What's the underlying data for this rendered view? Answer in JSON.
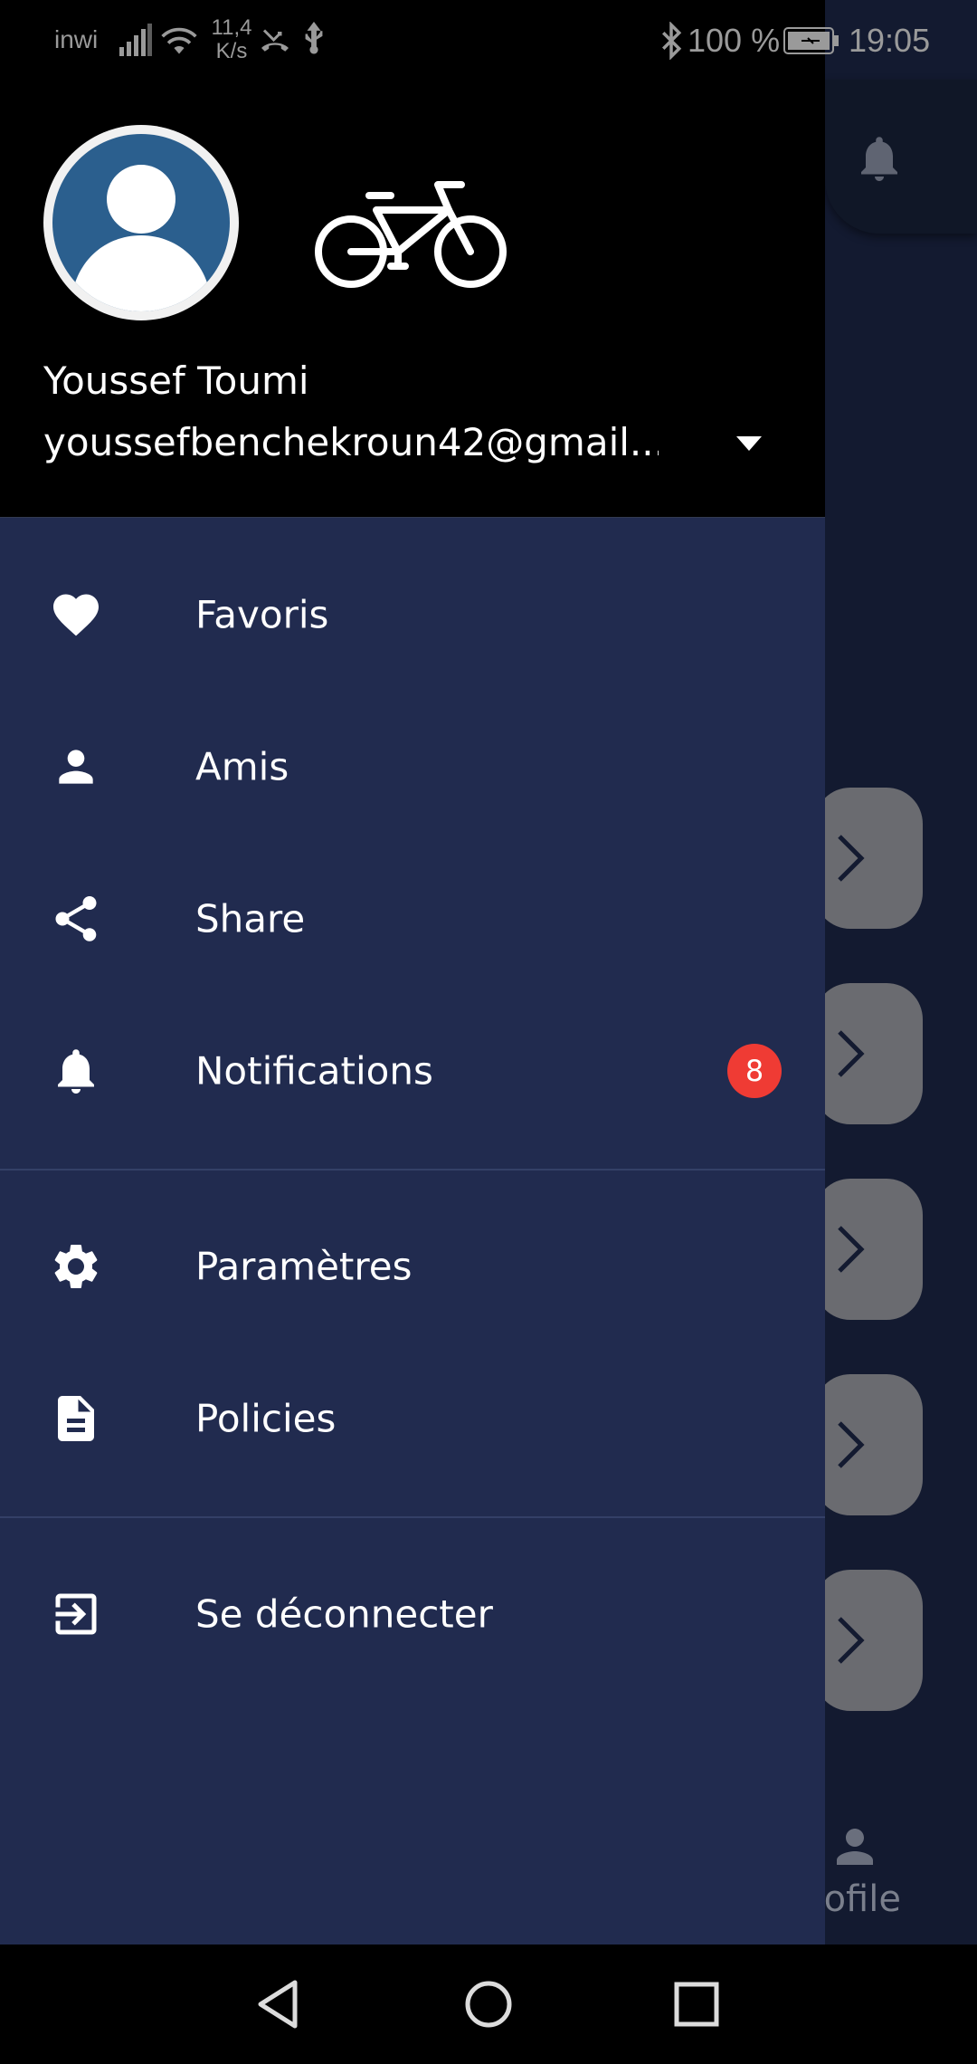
{
  "status_bar": {
    "carrier": "inwi",
    "net_speed_value": "11,4",
    "net_speed_unit": "K/s",
    "battery": "100 %",
    "time": "19:05",
    "icons": [
      "signal-icon",
      "wifi-icon",
      "missed-call-icon",
      "usb-icon",
      "bluetooth-icon",
      "battery-icon"
    ]
  },
  "drawer": {
    "header": {
      "name": "Youssef Toumi",
      "email": "youssefbenchekroun42@gmail...",
      "icons": [
        "avatar-icon",
        "bicycle-icon",
        "dropdown-arrow-icon"
      ]
    },
    "menu": {
      "favoris": {
        "label": "Favoris",
        "icon": "heart-icon"
      },
      "amis": {
        "label": "Amis",
        "icon": "person-icon"
      },
      "share": {
        "label": "Share",
        "icon": "share-icon"
      },
      "notifications": {
        "label": "Notifications",
        "icon": "bell-icon",
        "badge": "8"
      },
      "parametres": {
        "label": "Paramètres",
        "icon": "gear-icon"
      },
      "policies": {
        "label": "Policies",
        "icon": "document-icon"
      },
      "logout": {
        "label": "Se déconnecter",
        "icon": "logout-icon"
      }
    }
  },
  "background": {
    "profile_label": "rofile"
  },
  "colors": {
    "drawer_bg": "#212b4f",
    "header_bg": "#000000",
    "badge": "#ef3b34",
    "avatar": "#2b5f8e"
  }
}
